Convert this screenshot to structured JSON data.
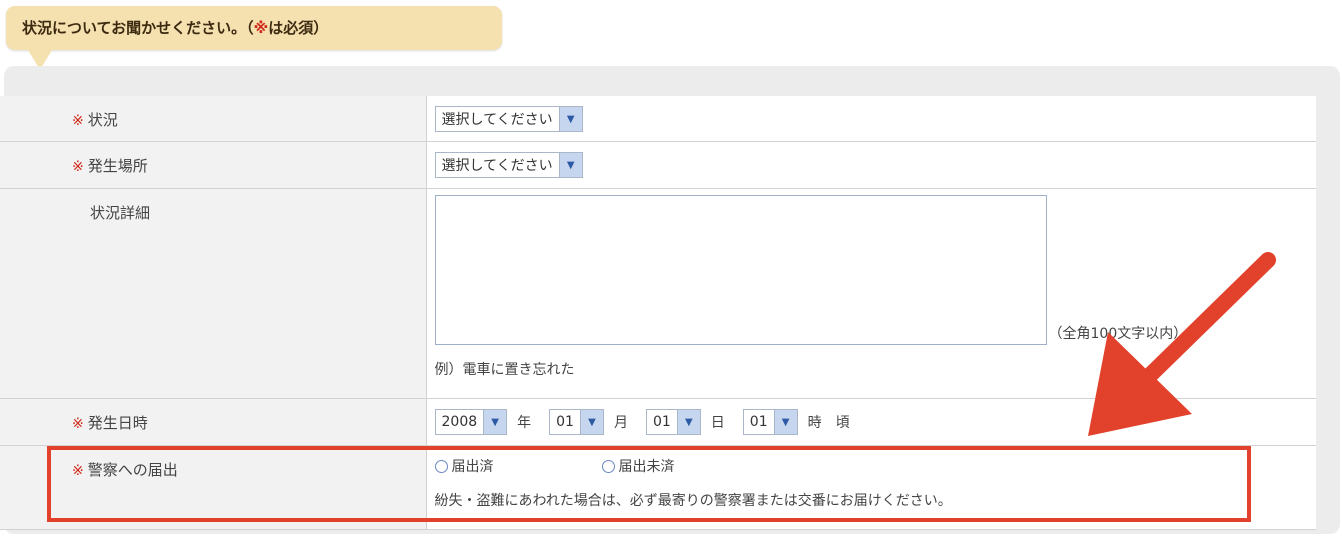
{
  "header": {
    "text": "状況についてお聞かせください。（",
    "mark": "※",
    "text_after": "は必須）"
  },
  "form": {
    "required_mark": "※",
    "rows": [
      {
        "label": "状況",
        "select": "選択してください"
      },
      {
        "label": "発生場所",
        "select": "選択してください"
      },
      {
        "label": "状況詳細",
        "limit": "（全角100文字以内）",
        "example": "例）電車に置き忘れた"
      },
      {
        "label": "発生日時",
        "year": "2008",
        "year_unit": "年",
        "month": "01",
        "month_unit": "月",
        "day": "01",
        "day_unit": "日",
        "hour": "01",
        "hour_unit": "時",
        "suffix": "頃"
      },
      {
        "label": "警察への届出",
        "radio_1": "届出済",
        "radio_2": "届出未済",
        "notice": "紛失・盗難にあわれた場合は、必ず最寄りの警察署または交番にお届けください。"
      }
    ]
  },
  "colors": {
    "highlight": "#e2412c",
    "required": "#d02a1a",
    "bubble": "#f5e0b0"
  },
  "icons": {
    "select_arrow": "chevron-down-icon",
    "annotation": "arrow-icon"
  }
}
